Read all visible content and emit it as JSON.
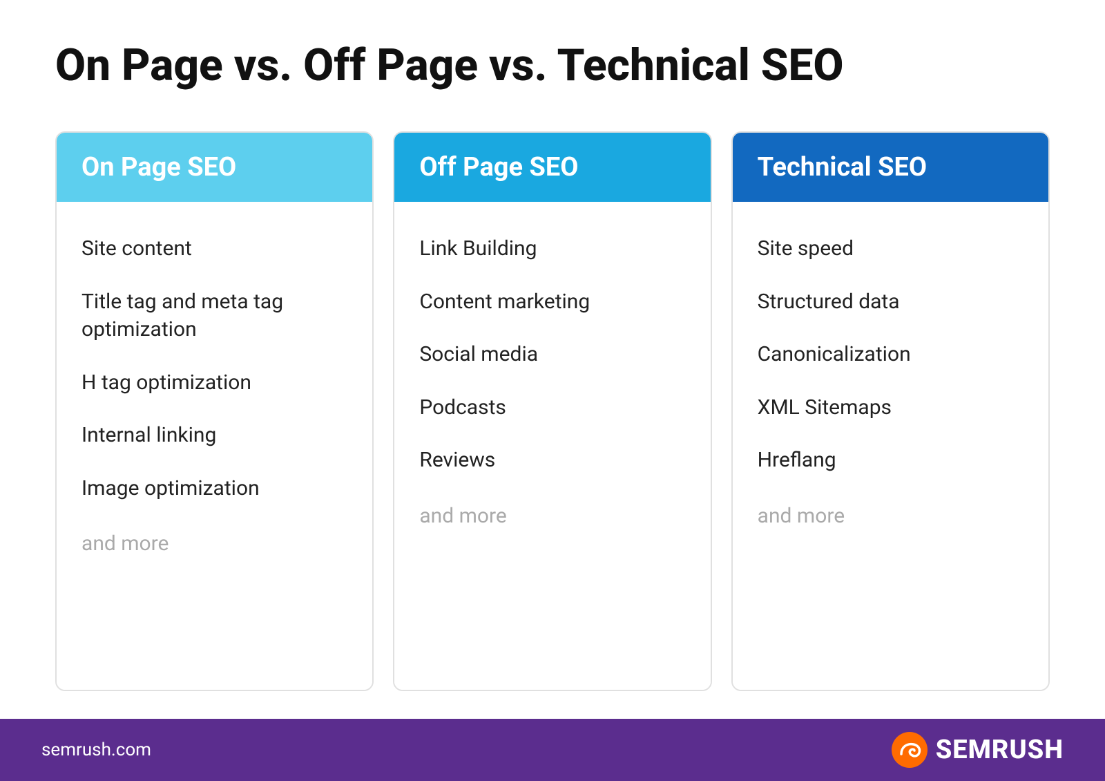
{
  "page": {
    "title": "On Page vs. Off Page vs. Technical SEO"
  },
  "columns": {
    "on_page": {
      "header": "On Page SEO",
      "items": [
        "Site content",
        "Title tag and meta tag optimization",
        "H tag optimization",
        "Internal linking",
        "Image optimization"
      ],
      "and_more": "and more"
    },
    "off_page": {
      "header": "Off Page SEO",
      "items": [
        "Link Building",
        "Content marketing",
        "Social media",
        "Podcasts",
        "Reviews"
      ],
      "and_more": "and more"
    },
    "technical": {
      "header": "Technical SEO",
      "items": [
        "Site speed",
        "Structured data",
        "Canonicalization",
        "XML Sitemaps",
        "Hreflang"
      ],
      "and_more": "and more"
    }
  },
  "footer": {
    "url": "semrush.com",
    "brand": "SEMRUSH"
  }
}
